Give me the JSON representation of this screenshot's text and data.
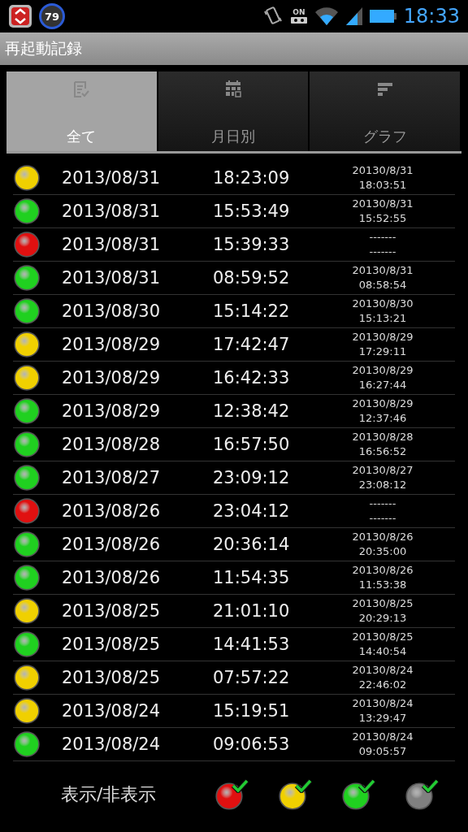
{
  "status_bar": {
    "badge": "79",
    "tape_label": "ON",
    "time": "18:33"
  },
  "title": "再起動記録",
  "tabs": [
    {
      "label": "全て",
      "kind": "list",
      "selected": true
    },
    {
      "label": "月日別",
      "kind": "calendar",
      "selected": false
    },
    {
      "label": "グラフ",
      "kind": "bars",
      "selected": false
    }
  ],
  "rows": [
    {
      "color": "#f0d000",
      "date": "2013/08/31",
      "time": "18:23:09",
      "prev_date": "20130/8/31",
      "prev_time": "18:03:51"
    },
    {
      "color": "#20d020",
      "date": "2013/08/31",
      "time": "15:53:49",
      "prev_date": "20130/8/31",
      "prev_time": "15:52:55"
    },
    {
      "color": "#e01010",
      "date": "2013/08/31",
      "time": "15:39:33",
      "prev_date": "-------",
      "prev_time": "-------"
    },
    {
      "color": "#20d020",
      "date": "2013/08/31",
      "time": "08:59:52",
      "prev_date": "20130/8/31",
      "prev_time": "08:58:54"
    },
    {
      "color": "#20d020",
      "date": "2013/08/30",
      "time": "15:14:22",
      "prev_date": "20130/8/30",
      "prev_time": "15:13:21"
    },
    {
      "color": "#f0d000",
      "date": "2013/08/29",
      "time": "17:42:47",
      "prev_date": "20130/8/29",
      "prev_time": "17:29:11"
    },
    {
      "color": "#f0d000",
      "date": "2013/08/29",
      "time": "16:42:33",
      "prev_date": "20130/8/29",
      "prev_time": "16:27:44"
    },
    {
      "color": "#20d020",
      "date": "2013/08/29",
      "time": "12:38:42",
      "prev_date": "20130/8/29",
      "prev_time": "12:37:46"
    },
    {
      "color": "#20d020",
      "date": "2013/08/28",
      "time": "16:57:50",
      "prev_date": "20130/8/28",
      "prev_time": "16:56:52"
    },
    {
      "color": "#20d020",
      "date": "2013/08/27",
      "time": "23:09:12",
      "prev_date": "20130/8/27",
      "prev_time": "23:08:12"
    },
    {
      "color": "#e01010",
      "date": "2013/08/26",
      "time": "23:04:12",
      "prev_date": "-------",
      "prev_time": "-------"
    },
    {
      "color": "#20d020",
      "date": "2013/08/26",
      "time": "20:36:14",
      "prev_date": "20130/8/26",
      "prev_time": "20:35:00"
    },
    {
      "color": "#20d020",
      "date": "2013/08/26",
      "time": "11:54:35",
      "prev_date": "20130/8/26",
      "prev_time": "11:53:38"
    },
    {
      "color": "#f0d000",
      "date": "2013/08/25",
      "time": "21:01:10",
      "prev_date": "20130/8/25",
      "prev_time": "20:29:13"
    },
    {
      "color": "#20d020",
      "date": "2013/08/25",
      "time": "14:41:53",
      "prev_date": "20130/8/25",
      "prev_time": "14:40:54"
    },
    {
      "color": "#f0d000",
      "date": "2013/08/25",
      "time": "07:57:22",
      "prev_date": "20130/8/24",
      "prev_time": "22:46:02"
    },
    {
      "color": "#f0d000",
      "date": "2013/08/24",
      "time": "15:19:51",
      "prev_date": "20130/8/24",
      "prev_time": "13:29:47"
    },
    {
      "color": "#20d020",
      "date": "2013/08/24",
      "time": "09:06:53",
      "prev_date": "20130/8/24",
      "prev_time": "09:05:57"
    }
  ],
  "footer": {
    "label": "表示/非表示",
    "filters": [
      {
        "color": "#e01010",
        "checked": true
      },
      {
        "color": "#f0d000",
        "checked": true
      },
      {
        "color": "#20d020",
        "checked": true
      },
      {
        "color": "#808080",
        "checked": true
      }
    ]
  }
}
